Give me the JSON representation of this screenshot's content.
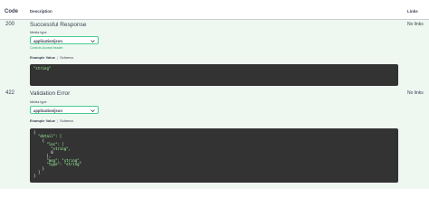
{
  "header": {
    "code": "Code",
    "description": "Description",
    "links": "Links"
  },
  "responses": [
    {
      "code": "200",
      "title": "Successful Response",
      "links": "No links",
      "media_type_label": "Media type",
      "media_type_value": "application/json",
      "accept_note": "Controls Accept header.",
      "tab_example": "Example Value",
      "tab_schema": "Schema",
      "example_lines": [
        "\"string\""
      ]
    },
    {
      "code": "422",
      "title": "Validation Error",
      "links": "No links",
      "media_type_label": "Media type",
      "media_type_value": "application/json",
      "tab_example": "Example Value",
      "tab_schema": "Schema",
      "example_lines": [
        "{",
        "  \"detail\": [",
        "    {",
        "      \"loc\": [",
        "        \"string\",",
        "        0",
        "      ],",
        "      \"msg\": \"string\",",
        "      \"type\": \"string\"",
        "    }",
        "  ]",
        "}"
      ]
    }
  ],
  "colors": {
    "row_bg": "#eef8f1",
    "select_border": "#49cc90",
    "code_bg": "#333333",
    "string_green": "#a2fca2"
  },
  "icons": {
    "select_chevron": "chevron-down-icon"
  }
}
